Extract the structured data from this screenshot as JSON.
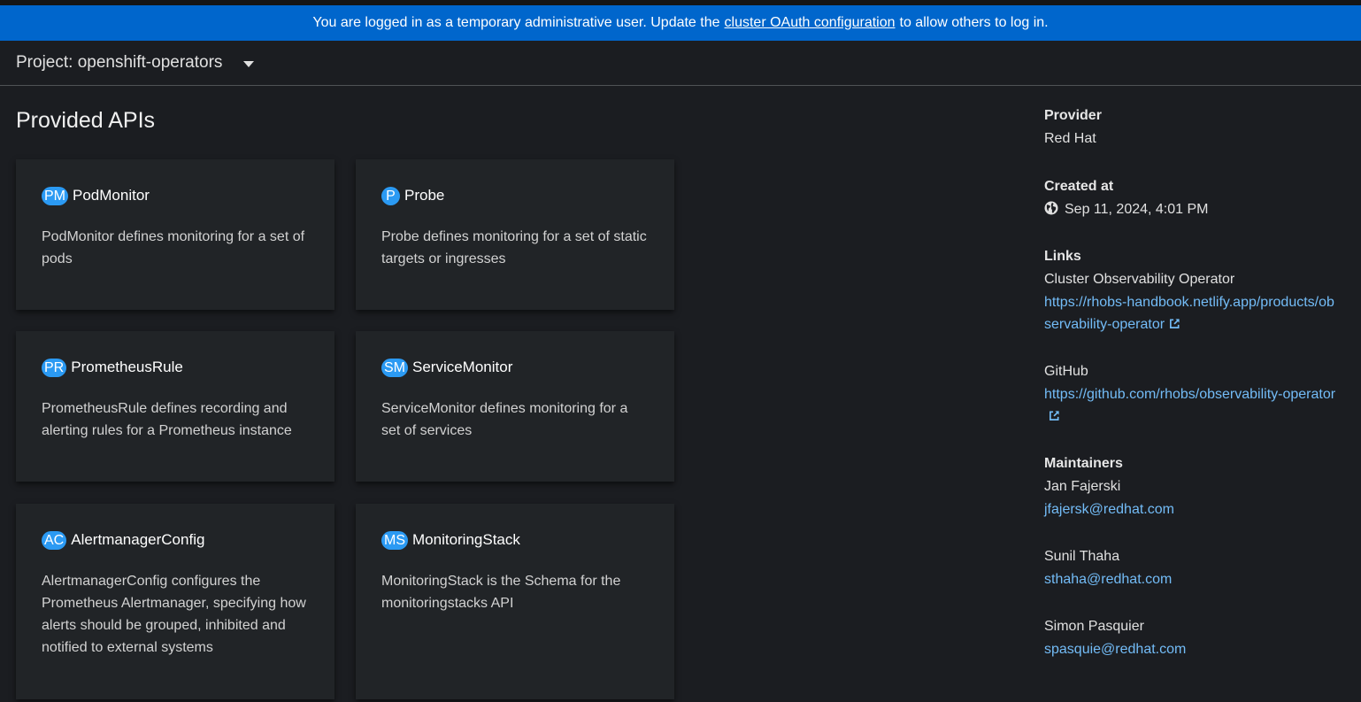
{
  "banner": {
    "text_before": "You are logged in as a temporary administrative user. Update the",
    "link_text": "cluster OAuth configuration",
    "text_after": "to allow others to log in."
  },
  "project": {
    "label": "Project: openshift-operators"
  },
  "section": {
    "title": "Provided APIs"
  },
  "apis": [
    {
      "abbr": "PM",
      "name": "PodMonitor",
      "desc": "PodMonitor defines monitoring for a set of pods"
    },
    {
      "abbr": "P",
      "name": "Probe",
      "desc": "Probe defines monitoring for a set of static targets or ingresses"
    },
    {
      "abbr": "PR",
      "name": "PrometheusRule",
      "desc": "PrometheusRule defines recording and alerting rules for a Prometheus instance"
    },
    {
      "abbr": "SM",
      "name": "ServiceMonitor",
      "desc": "ServiceMonitor defines monitoring for a set of services"
    },
    {
      "abbr": "AC",
      "name": "AlertmanagerConfig",
      "desc": "AlertmanagerConfig configures the Prometheus Alertmanager, specifying how alerts should be grouped, inhibited and notified to external systems"
    },
    {
      "abbr": "MS",
      "name": "MonitoringStack",
      "desc": "MonitoringStack is the Schema for the monitoringstacks API"
    }
  ],
  "details": {
    "provider_label": "Provider",
    "provider_value": "Red Hat",
    "created_label": "Created at",
    "created_value": "Sep 11, 2024, 4:01 PM",
    "links_label": "Links",
    "links": [
      {
        "name": "Cluster Observability Operator",
        "url": "https://rhobs-handbook.netlify.app/products/observability-operator"
      },
      {
        "name": "GitHub",
        "url": "https://github.com/rhobs/observability-operator"
      }
    ],
    "maintainers_label": "Maintainers",
    "maintainers": [
      {
        "name": "Jan Fajerski",
        "email": "jfajersk@redhat.com"
      },
      {
        "name": "Sunil Thaha",
        "email": "sthaha@redhat.com"
      },
      {
        "name": "Simon Pasquier",
        "email": "spasquie@redhat.com"
      }
    ]
  },
  "colors": {
    "banner": "#0066cc",
    "badge": "#2b9af3",
    "link": "#73bcf7",
    "background": "#1b1d21",
    "card": "#212427"
  },
  "icons": [
    "caret-down-icon",
    "globe-icon",
    "external-link-icon"
  ]
}
